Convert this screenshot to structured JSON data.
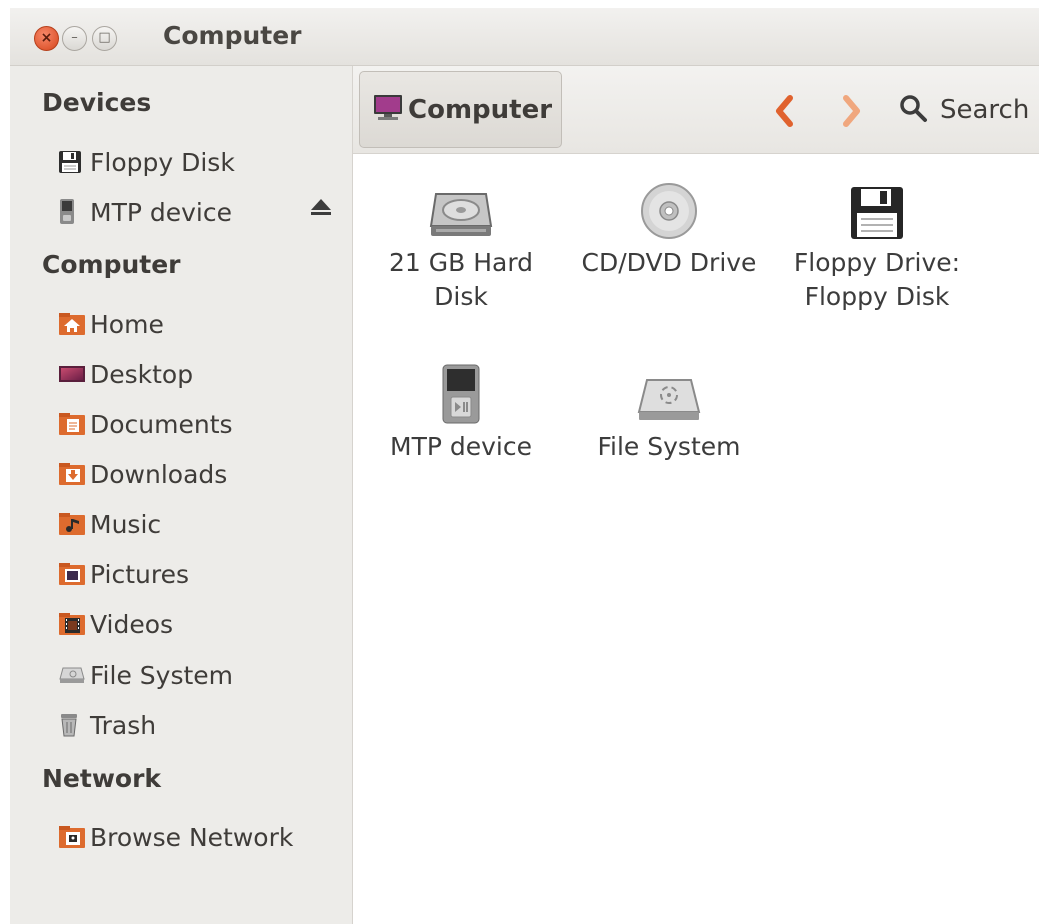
{
  "window": {
    "title": "Computer",
    "controls": {
      "close": "×",
      "minimize": "–",
      "maximize": "□"
    }
  },
  "sidebar": {
    "sections": [
      {
        "heading": "Devices",
        "items": [
          {
            "label": "Floppy Disk",
            "icon": "floppy-icon"
          },
          {
            "label": "MTP device",
            "icon": "media-player-icon",
            "eject": true
          }
        ]
      },
      {
        "heading": "Computer",
        "items": [
          {
            "label": "Home",
            "icon": "home-folder-icon"
          },
          {
            "label": "Desktop",
            "icon": "desktop-icon"
          },
          {
            "label": "Documents",
            "icon": "documents-folder-icon"
          },
          {
            "label": "Downloads",
            "icon": "downloads-folder-icon"
          },
          {
            "label": "Music",
            "icon": "music-folder-icon"
          },
          {
            "label": "Pictures",
            "icon": "pictures-folder-icon"
          },
          {
            "label": "Videos",
            "icon": "videos-folder-icon"
          },
          {
            "label": "File System",
            "icon": "filesystem-icon"
          },
          {
            "label": "Trash",
            "icon": "trash-icon"
          }
        ]
      },
      {
        "heading": "Network",
        "items": [
          {
            "label": "Browse Network",
            "icon": "network-folder-icon"
          }
        ]
      }
    ]
  },
  "toolbar": {
    "location": "Computer",
    "search_label": "Search"
  },
  "content": {
    "items": [
      {
        "name": "21 GB Hard Disk",
        "icon": "hard-disk-icon"
      },
      {
        "name": "CD/DVD Drive",
        "icon": "optical-drive-icon"
      },
      {
        "name": "Floppy Drive: Floppy Disk",
        "icon": "floppy-drive-icon"
      },
      {
        "name": "MTP device",
        "icon": "media-player-icon"
      },
      {
        "name": "File System",
        "icon": "filesystem-icon"
      }
    ]
  },
  "colors": {
    "accent": "#dd4814",
    "sidebar_bg": "#edece9",
    "close_button": "#e05a33"
  }
}
